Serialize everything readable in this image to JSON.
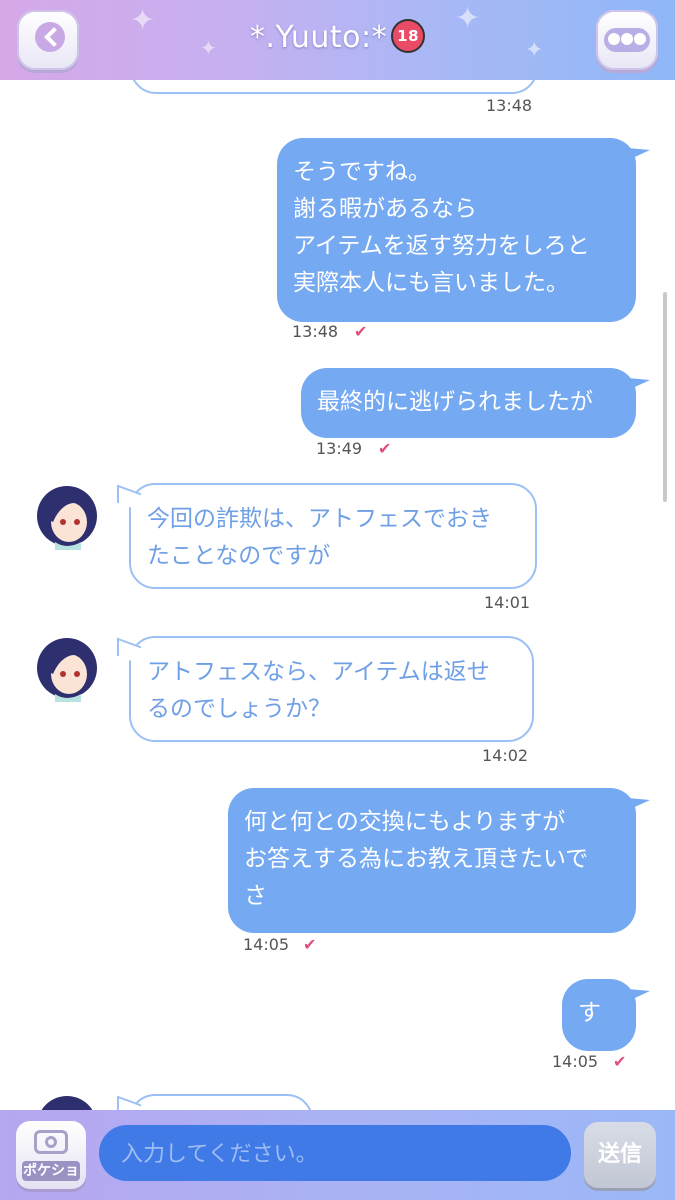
{
  "header": {
    "title": "*.Yuuto:*",
    "title_badge": "18",
    "back_icon": "chevron-left-icon",
    "more_icon": "ellipsis-icon"
  },
  "messages": [
    {
      "side": "in",
      "text": "",
      "time": "13:48"
    },
    {
      "side": "out",
      "text": "そうですね。\n謝る暇があるなら\nアイテムを返す努力をしろと\n実際本人にも言いました。",
      "time": "13:48",
      "read_icon": "check-icon"
    },
    {
      "side": "out",
      "text": "最終的に逃げられましたが",
      "time": "13:49",
      "read_icon": "check-icon"
    },
    {
      "side": "in",
      "text": "今回の詐欺は、アトフェスでおき\nたことなのですが",
      "time": "14:01"
    },
    {
      "side": "in",
      "text": "アトフェスなら、アイテムは返せ\nるのでしょうか？",
      "time": "14:02"
    },
    {
      "side": "out",
      "text": "何と何との交換にもよりますが\nお答えする為にお教え頂きたいで\nさ",
      "time": "14:05",
      "read_icon": "check-icon"
    },
    {
      "side": "out",
      "text": "す",
      "time": "14:05",
      "read_icon": "check-icon"
    },
    {
      "side": "in",
      "text": "",
      "time": ""
    }
  ],
  "footer": {
    "camera_label": "ポケショ",
    "camera_icon": "camera-icon",
    "input_placeholder": "入力してください。",
    "input_value": "",
    "send_label": "送信"
  },
  "colors": {
    "outgoing_bubble": "#75a9f2",
    "incoming_border": "#9cc0f3",
    "incoming_text": "#6f9fe6",
    "read_check": "#e0507a",
    "input_bg": "#3f7ae6"
  }
}
